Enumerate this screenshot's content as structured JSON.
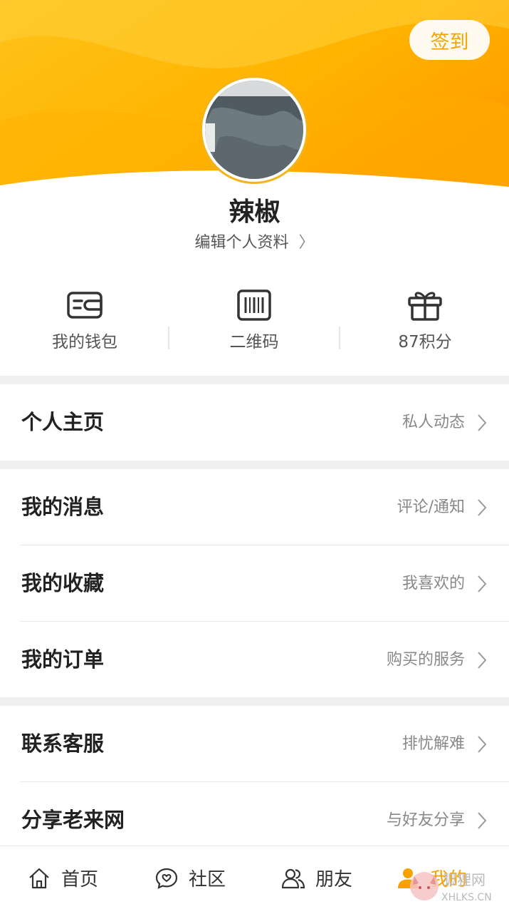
{
  "header": {
    "checkin_label": "签到",
    "accent": "#f6a300"
  },
  "profile": {
    "username": "辣椒",
    "edit_label": "编辑个人资料"
  },
  "quick_actions": [
    {
      "label": "我的钱包",
      "icon": "wallet-icon"
    },
    {
      "label": "二维码",
      "icon": "barcode-icon"
    },
    {
      "label": "87积分",
      "icon": "gift-icon"
    }
  ],
  "menu": {
    "homepage": {
      "title": "个人主页",
      "desc": "私人动态"
    },
    "messages": {
      "title": "我的消息",
      "desc": "评论/通知"
    },
    "favorites": {
      "title": "我的收藏",
      "desc": "我喜欢的"
    },
    "orders": {
      "title": "我的订单",
      "desc": "购买的服务"
    },
    "service": {
      "title": "联系客服",
      "desc": "排忧解难"
    },
    "share": {
      "title": "分享老来网",
      "desc": "与好友分享"
    }
  },
  "bottom_nav": [
    {
      "label": "首页",
      "icon": "home-icon"
    },
    {
      "label": "社区",
      "icon": "chat-heart-icon"
    },
    {
      "label": "朋友",
      "icon": "friends-icon"
    },
    {
      "label": "我的",
      "icon": "user-icon",
      "active": true
    }
  ],
  "watermark": "狐狸网 XHLKS.CN"
}
